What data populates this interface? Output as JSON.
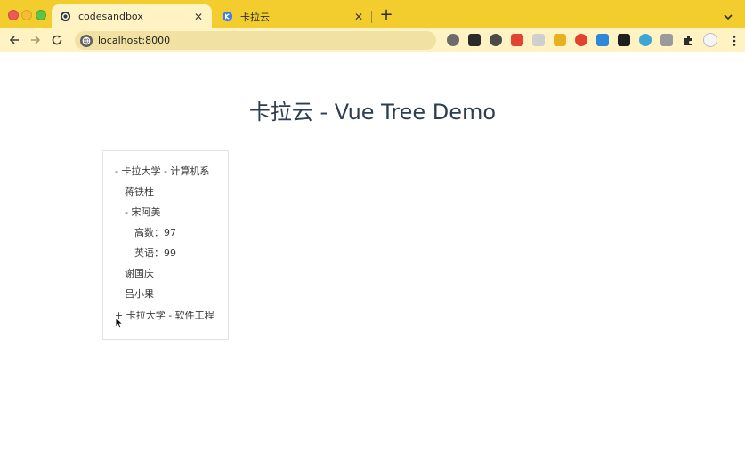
{
  "tabs": [
    {
      "title": "codesandbox",
      "active": true
    },
    {
      "title": "卡拉云",
      "active": false
    }
  ],
  "toolbar": {
    "url": "localhost:8000"
  },
  "page": {
    "title": "卡拉云 - Vue Tree Demo",
    "tree": [
      {
        "label": "- 卡拉大学 - 计算机系",
        "level": 0
      },
      {
        "label": "蒋铁柱",
        "level": 1
      },
      {
        "label": "- 宋阿美",
        "level": 1
      },
      {
        "label": "高数：97",
        "level": 2
      },
      {
        "label": "英语：99",
        "level": 2
      },
      {
        "label": "谢国庆",
        "level": 1
      },
      {
        "label": "吕小果",
        "level": 1
      },
      {
        "label": "+ 卡拉大学 - 软件工程",
        "level": 0
      }
    ]
  },
  "colors": {
    "tabstrip": "#f3cc2d",
    "toolbar": "#fff2c3",
    "title_text": "#2c3e50"
  }
}
